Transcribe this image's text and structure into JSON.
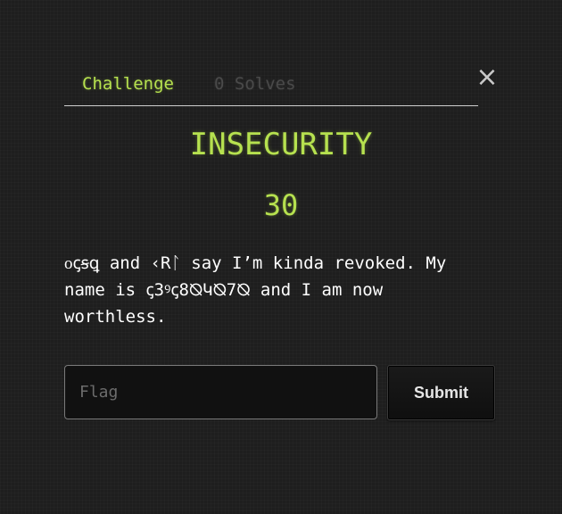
{
  "tabs": {
    "challenge_label": "Challenge",
    "solves_label": "0 Solves"
  },
  "close_label": "×",
  "challenge": {
    "name": "INSECURITY",
    "points": "30",
    "description": "ᴏꞔꞩꝗ and ‹Rᛚ say I’m kinda revoked. My\nname is ꞔ3ꝰꞔ8⦰Կ⦰7⦰ and I am now\nworthless."
  },
  "form": {
    "flag_placeholder": "Flag",
    "flag_value": "",
    "submit_label": "Submit"
  },
  "colors": {
    "accent": "#b6e14f",
    "background": "#1e1e1e",
    "muted_tab": "#4a4a4a"
  },
  "icons": {
    "close": "close-icon"
  }
}
